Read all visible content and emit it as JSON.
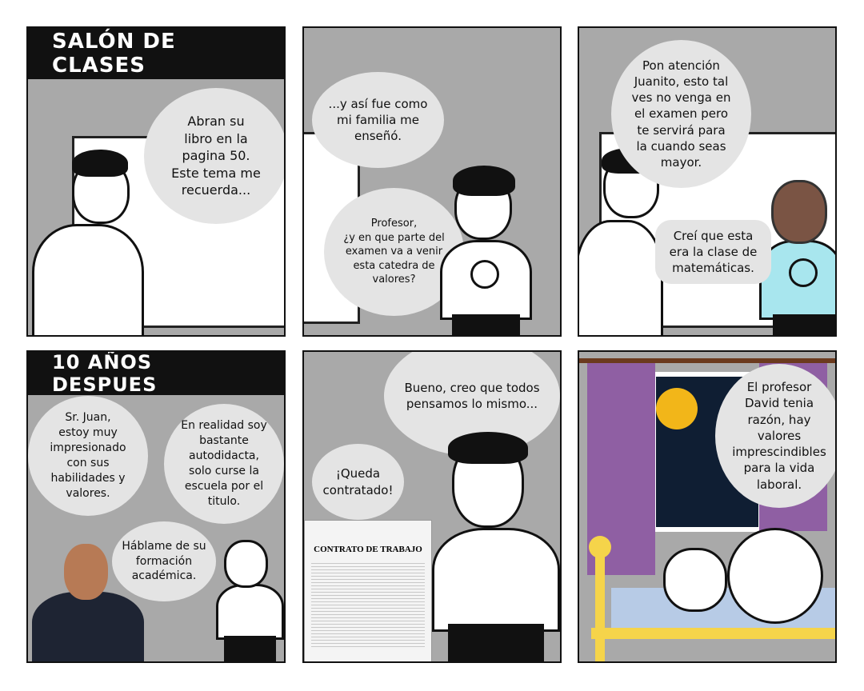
{
  "panels": [
    {
      "title": "SALÓN DE CLASES",
      "bubbles": [
        "Abran su\nlibro en la\npagina 50.\nEste tema me\nrecuerda..."
      ]
    },
    {
      "bubbles": [
        "...y así fue como\nmi familia me\nenseñó.",
        "Profesor,\n¿y en que parte del\nexamen va a venir\nesta catedra de\nvalores?"
      ]
    },
    {
      "bubbles": [
        "Pon atención\nJuanito, esto tal\nves no venga en\nel examen pero\nte servirá para\nla cuando seas\nmayor.",
        "Creí que esta\nera la clase de\nmatemáticas."
      ]
    },
    {
      "title": "10 AÑOS DESPUES",
      "bubbles": [
        "Sr. Juan,\nestoy muy\nimpresionado\ncon sus\nhabilidades y\nvalores.",
        "En realidad soy\nbastante\nautodidacta,\nsolo curse la\nescuela por el\ntitulo.",
        "Háblame de su\nformación\nacadémica."
      ]
    },
    {
      "bubbles": [
        "Bueno, creo que todos\npensamos lo mismo...",
        "¡Queda\ncontratado!"
      ],
      "document_title": "CONTRATO DE TRABAJO"
    },
    {
      "bubbles": [
        "El profesor\nDavid tenia\nrazón, hay\nvalores\nimprescindibles\npara la vida\nlaboral."
      ]
    }
  ],
  "colors": {
    "panel_bg": "#a9a9a9",
    "bubble": "#e4e4e4",
    "shirt_blue": "#a8e6ee",
    "curtain": "#8f5fa3",
    "bed": "#f5d44a",
    "moon": "#f2b619"
  }
}
